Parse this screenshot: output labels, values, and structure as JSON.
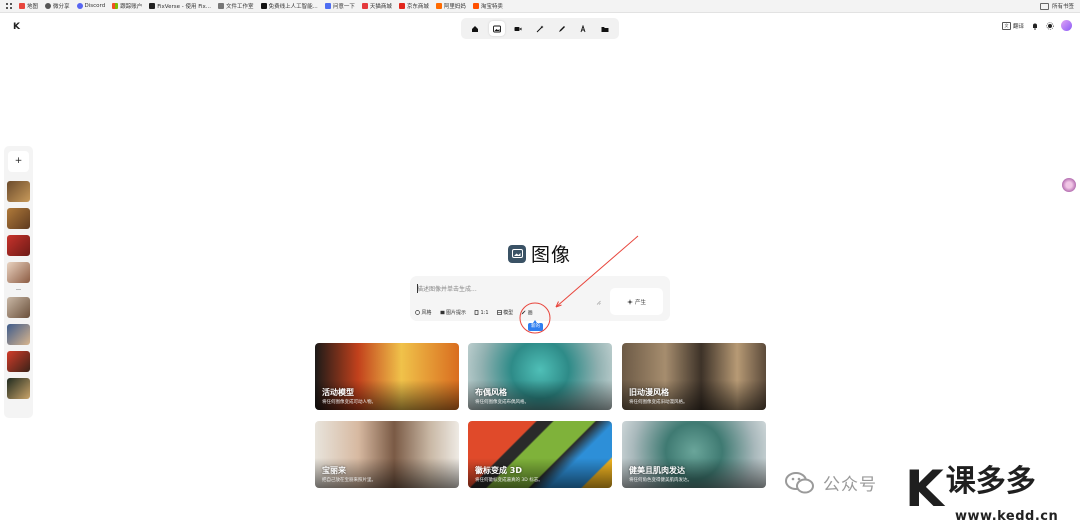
{
  "bookmarks": [
    {
      "label": "地图",
      "icon": "map-icon",
      "color": "#e8453c"
    },
    {
      "label": "微分享",
      "icon": "share-icon",
      "color": "#555555"
    },
    {
      "label": "Discord",
      "icon": "discord-icon",
      "color": "#5865f2"
    },
    {
      "label": "跟踪账户",
      "icon": "tracking-icon",
      "color": "#ffb900"
    },
    {
      "label": "FixVerse - 使用 Fix...",
      "icon": "fixverse-icon",
      "color": "#222222"
    },
    {
      "label": "文件工作室",
      "icon": "studio-icon",
      "color": "#555555"
    },
    {
      "label": "免费线上人工智能...",
      "icon": "ai-icon",
      "color": "#111111"
    },
    {
      "label": "问意一下",
      "icon": "ask-icon",
      "color": "#4e6ef2"
    },
    {
      "label": "天猫商城",
      "icon": "tmall-icon",
      "color": "#e4393c"
    },
    {
      "label": "京东商城",
      "icon": "jd-icon",
      "color": "#e1251b"
    },
    {
      "label": "阿里妈妈",
      "icon": "alimama-icon",
      "color": "#ff6a00"
    },
    {
      "label": "淘宝特卖",
      "icon": "taobao-icon",
      "color": "#ff5000"
    }
  ],
  "bookmarks_right": "所有书签",
  "logo": "K",
  "nav": {
    "items": [
      "home",
      "image",
      "video",
      "magic",
      "edit",
      "text",
      "folder"
    ],
    "active": "image"
  },
  "top_right": {
    "translate_label": "翻译",
    "translate_icon_text": "文"
  },
  "hero": {
    "title": "图像"
  },
  "prompt": {
    "placeholder": "描述图像并单击生成...",
    "generate_label": "产生",
    "tools": [
      {
        "label": "风格",
        "icon": "style-icon"
      },
      {
        "label": "图片提示",
        "icon": "image-prompt-icon"
      },
      {
        "label": "1:1",
        "icon": "ratio-icon"
      },
      {
        "label": "模型",
        "icon": "model-icon"
      },
      {
        "label": "画",
        "icon": "brush-icon"
      }
    ],
    "new_badge": "新的"
  },
  "cards": [
    {
      "title": "活动模型",
      "desc": "将任何图像变成可动人物。"
    },
    {
      "title": "布偶风格",
      "desc": "将任何图像变成布偶风格。"
    },
    {
      "title": "旧动漫风格",
      "desc": "将任何图像变成旧动漫风格。"
    },
    {
      "title": "宝丽来",
      "desc": "把自己放在宝丽来照片里。"
    },
    {
      "title": "徽标变成 3D",
      "desc": "将任何徽标变成逼真的 3D 标志。"
    },
    {
      "title": "健美且肌肉发达",
      "desc": "将任何角色变得健美肌肉发达。"
    }
  ],
  "watermark": {
    "public": "公众号",
    "logo_k": "K",
    "name": "课多多",
    "url": "www.kedd.cn"
  },
  "colors": {
    "accent": "#2f7ff0",
    "annotation": "#e8453c",
    "hero_icon": "#3a5265"
  }
}
